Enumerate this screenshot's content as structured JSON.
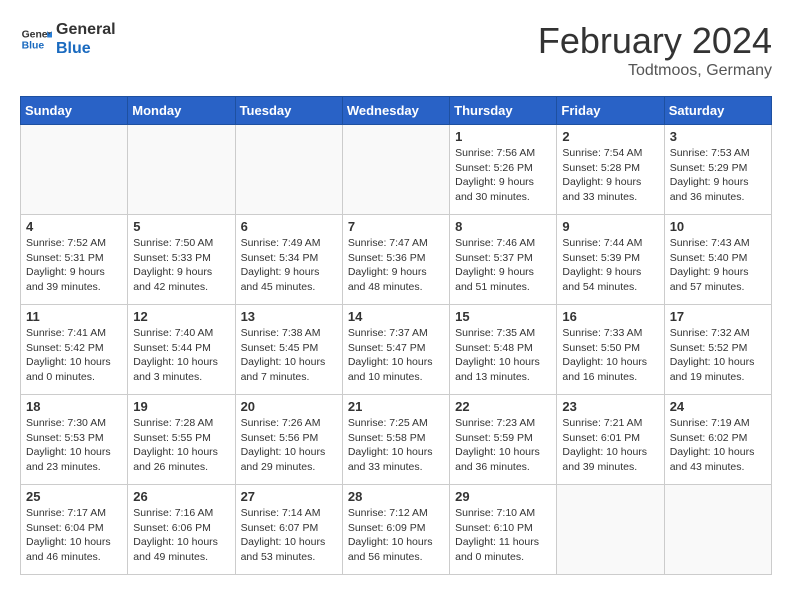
{
  "header": {
    "logo_line1": "General",
    "logo_line2": "Blue",
    "month": "February 2024",
    "location": "Todtmoos, Germany"
  },
  "weekdays": [
    "Sunday",
    "Monday",
    "Tuesday",
    "Wednesday",
    "Thursday",
    "Friday",
    "Saturday"
  ],
  "weeks": [
    [
      {
        "day": "",
        "info": ""
      },
      {
        "day": "",
        "info": ""
      },
      {
        "day": "",
        "info": ""
      },
      {
        "day": "",
        "info": ""
      },
      {
        "day": "1",
        "info": "Sunrise: 7:56 AM\nSunset: 5:26 PM\nDaylight: 9 hours\nand 30 minutes."
      },
      {
        "day": "2",
        "info": "Sunrise: 7:54 AM\nSunset: 5:28 PM\nDaylight: 9 hours\nand 33 minutes."
      },
      {
        "day": "3",
        "info": "Sunrise: 7:53 AM\nSunset: 5:29 PM\nDaylight: 9 hours\nand 36 minutes."
      }
    ],
    [
      {
        "day": "4",
        "info": "Sunrise: 7:52 AM\nSunset: 5:31 PM\nDaylight: 9 hours\nand 39 minutes."
      },
      {
        "day": "5",
        "info": "Sunrise: 7:50 AM\nSunset: 5:33 PM\nDaylight: 9 hours\nand 42 minutes."
      },
      {
        "day": "6",
        "info": "Sunrise: 7:49 AM\nSunset: 5:34 PM\nDaylight: 9 hours\nand 45 minutes."
      },
      {
        "day": "7",
        "info": "Sunrise: 7:47 AM\nSunset: 5:36 PM\nDaylight: 9 hours\nand 48 minutes."
      },
      {
        "day": "8",
        "info": "Sunrise: 7:46 AM\nSunset: 5:37 PM\nDaylight: 9 hours\nand 51 minutes."
      },
      {
        "day": "9",
        "info": "Sunrise: 7:44 AM\nSunset: 5:39 PM\nDaylight: 9 hours\nand 54 minutes."
      },
      {
        "day": "10",
        "info": "Sunrise: 7:43 AM\nSunset: 5:40 PM\nDaylight: 9 hours\nand 57 minutes."
      }
    ],
    [
      {
        "day": "11",
        "info": "Sunrise: 7:41 AM\nSunset: 5:42 PM\nDaylight: 10 hours\nand 0 minutes."
      },
      {
        "day": "12",
        "info": "Sunrise: 7:40 AM\nSunset: 5:44 PM\nDaylight: 10 hours\nand 3 minutes."
      },
      {
        "day": "13",
        "info": "Sunrise: 7:38 AM\nSunset: 5:45 PM\nDaylight: 10 hours\nand 7 minutes."
      },
      {
        "day": "14",
        "info": "Sunrise: 7:37 AM\nSunset: 5:47 PM\nDaylight: 10 hours\nand 10 minutes."
      },
      {
        "day": "15",
        "info": "Sunrise: 7:35 AM\nSunset: 5:48 PM\nDaylight: 10 hours\nand 13 minutes."
      },
      {
        "day": "16",
        "info": "Sunrise: 7:33 AM\nSunset: 5:50 PM\nDaylight: 10 hours\nand 16 minutes."
      },
      {
        "day": "17",
        "info": "Sunrise: 7:32 AM\nSunset: 5:52 PM\nDaylight: 10 hours\nand 19 minutes."
      }
    ],
    [
      {
        "day": "18",
        "info": "Sunrise: 7:30 AM\nSunset: 5:53 PM\nDaylight: 10 hours\nand 23 minutes."
      },
      {
        "day": "19",
        "info": "Sunrise: 7:28 AM\nSunset: 5:55 PM\nDaylight: 10 hours\nand 26 minutes."
      },
      {
        "day": "20",
        "info": "Sunrise: 7:26 AM\nSunset: 5:56 PM\nDaylight: 10 hours\nand 29 minutes."
      },
      {
        "day": "21",
        "info": "Sunrise: 7:25 AM\nSunset: 5:58 PM\nDaylight: 10 hours\nand 33 minutes."
      },
      {
        "day": "22",
        "info": "Sunrise: 7:23 AM\nSunset: 5:59 PM\nDaylight: 10 hours\nand 36 minutes."
      },
      {
        "day": "23",
        "info": "Sunrise: 7:21 AM\nSunset: 6:01 PM\nDaylight: 10 hours\nand 39 minutes."
      },
      {
        "day": "24",
        "info": "Sunrise: 7:19 AM\nSunset: 6:02 PM\nDaylight: 10 hours\nand 43 minutes."
      }
    ],
    [
      {
        "day": "25",
        "info": "Sunrise: 7:17 AM\nSunset: 6:04 PM\nDaylight: 10 hours\nand 46 minutes."
      },
      {
        "day": "26",
        "info": "Sunrise: 7:16 AM\nSunset: 6:06 PM\nDaylight: 10 hours\nand 49 minutes."
      },
      {
        "day": "27",
        "info": "Sunrise: 7:14 AM\nSunset: 6:07 PM\nDaylight: 10 hours\nand 53 minutes."
      },
      {
        "day": "28",
        "info": "Sunrise: 7:12 AM\nSunset: 6:09 PM\nDaylight: 10 hours\nand 56 minutes."
      },
      {
        "day": "29",
        "info": "Sunrise: 7:10 AM\nSunset: 6:10 PM\nDaylight: 11 hours\nand 0 minutes."
      },
      {
        "day": "",
        "info": ""
      },
      {
        "day": "",
        "info": ""
      }
    ]
  ]
}
